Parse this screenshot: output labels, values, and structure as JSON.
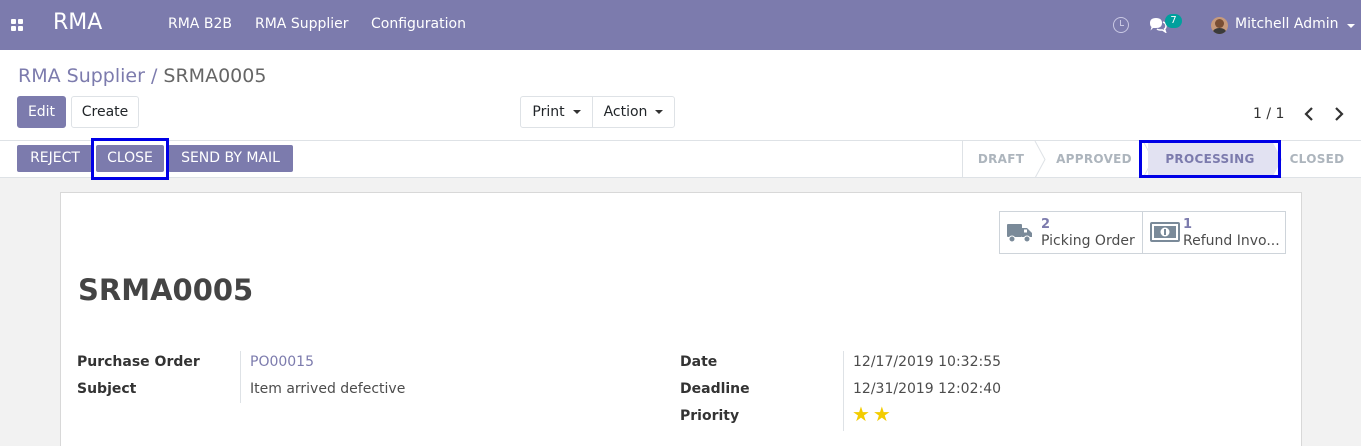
{
  "navbar": {
    "brand": "RMA",
    "menu": [
      "RMA B2B",
      "RMA Supplier",
      "Configuration"
    ],
    "messages_count": "7",
    "user_name": "Mitchell Admin"
  },
  "breadcrumb": {
    "parent": "RMA Supplier",
    "separator": "/",
    "current": "SRMA0005"
  },
  "control_panel": {
    "edit_label": "Edit",
    "create_label": "Create",
    "print_label": "Print",
    "action_label": "Action",
    "pager_value": "1 / 1"
  },
  "statusbar": {
    "buttons": [
      "REJECT",
      "CLOSE",
      "SEND BY MAIL"
    ],
    "stages": [
      "DRAFT",
      "APPROVED",
      "PROCESSING",
      "CLOSED"
    ],
    "active_stage": "PROCESSING"
  },
  "stat_buttons": [
    {
      "value": "2",
      "label": "Picking Order",
      "icon": "truck-icon"
    },
    {
      "value": "1",
      "label": "Refund Invo...",
      "icon": "money-icon"
    }
  ],
  "record": {
    "title": "SRMA0005",
    "fields_left": [
      {
        "label": "Purchase Order",
        "value": "PO00015"
      },
      {
        "label": "Subject",
        "value": "Item arrived defective"
      }
    ],
    "fields_right": [
      {
        "label": "Date",
        "value": "12/17/2019 10:32:55"
      },
      {
        "label": "Deadline",
        "value": "12/31/2019 12:02:40"
      },
      {
        "label": "Priority",
        "value": "★★"
      }
    ]
  },
  "colors": {
    "brand": "#7c7bad",
    "highlight": "#0000e6",
    "star": "#f3cc00",
    "badge": "#00a09d"
  }
}
